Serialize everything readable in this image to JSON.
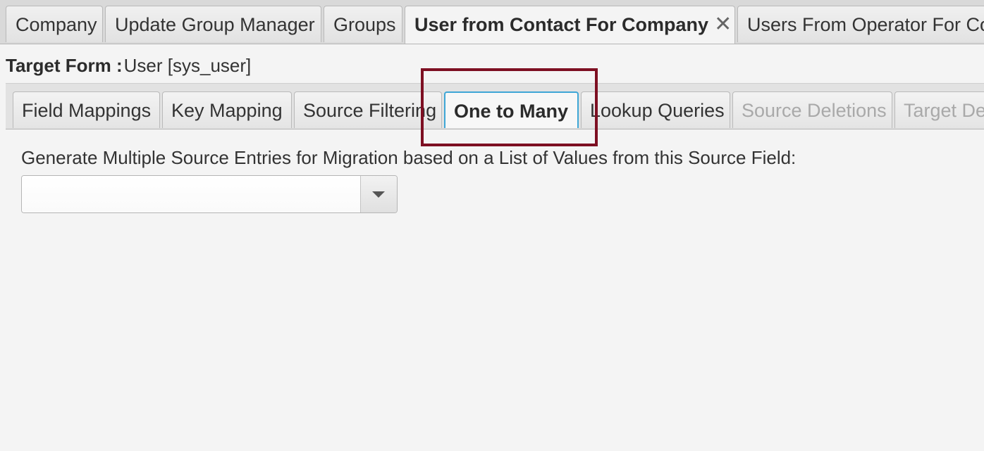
{
  "doc_tabs": [
    {
      "label": "Company"
    },
    {
      "label": "Update Group Manager"
    },
    {
      "label": "Groups"
    },
    {
      "label": "User from Contact For Company",
      "active": true
    },
    {
      "label": "Users From Operator For Co"
    }
  ],
  "close_glyph": "✕",
  "target_form": {
    "label": "Target Form :",
    "value": "User [sys_user]"
  },
  "sub_tabs": [
    {
      "label": "Field Mappings"
    },
    {
      "label": "Key Mapping"
    },
    {
      "label": "Source Filtering"
    },
    {
      "label": "One to Many",
      "active": true
    },
    {
      "label": "Lookup Queries"
    },
    {
      "label": "Source Deletions",
      "disabled": true
    },
    {
      "label": "Target De",
      "disabled": true
    }
  ],
  "content": {
    "source_field_label": "Generate Multiple Source Entries for Migration based on a List of Values from this Source Field:",
    "source_field_value": ""
  },
  "colors": {
    "active_tab_border": "#3ea6d6",
    "highlight": "#7d0f22",
    "background": "#f4f4f4"
  },
  "icons": [
    "close-icon",
    "chevron-down-icon"
  ]
}
